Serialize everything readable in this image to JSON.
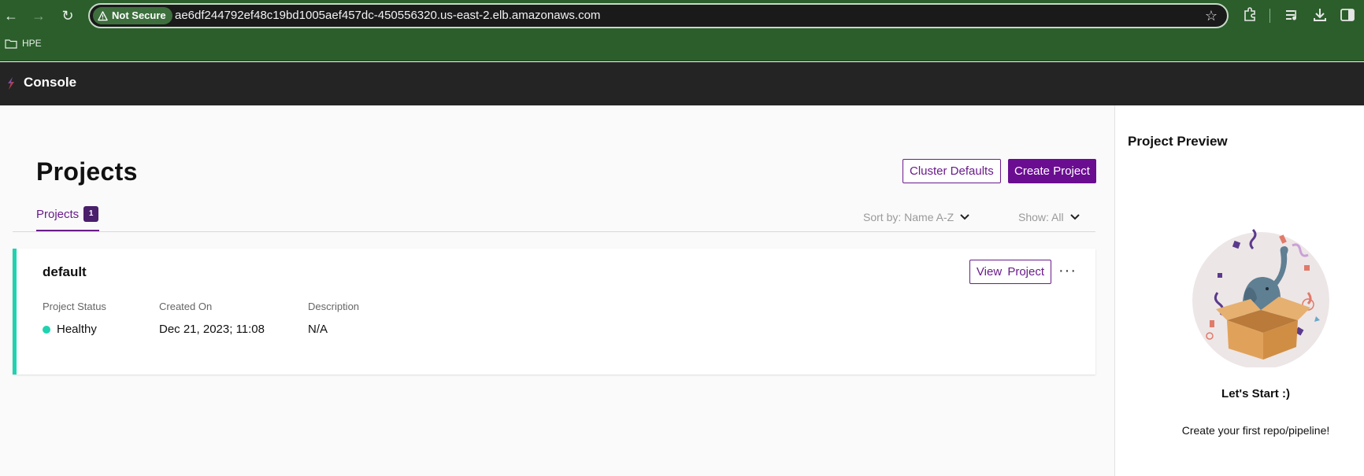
{
  "browser": {
    "security_label": "Not Secure",
    "url": "ae6df244792ef48c19bd1005aef457dc-450556320.us-east-2.elb.amazonaws.com",
    "bookmark_label": "HPE"
  },
  "app": {
    "title": "Console"
  },
  "page": {
    "title": "Projects",
    "cluster_defaults_label": "Cluster Defaults",
    "create_project_label": "Create Project",
    "tab_label": "Projects",
    "tab_count": "1",
    "sort_label": "Sort by: Name A-Z",
    "show_label": "Show: All"
  },
  "projects": [
    {
      "name": "default",
      "view_label": "View  Project",
      "status_label": "Project Status",
      "status_value": "Healthy",
      "status_color": "#1fd3b0",
      "created_label": "Created On",
      "created_value": "Dec 21, 2023; 11:08",
      "description_label": "Description",
      "description_value": "N/A"
    }
  ],
  "preview": {
    "title": "Project Preview",
    "heading": "Let's Start :)",
    "text": "Create your first repo/pipeline!"
  },
  "colors": {
    "browser_chrome": "#2b5e2b",
    "app_header": "#242424",
    "accent": "#6a0d91",
    "status_healthy": "#1fd3b0"
  }
}
